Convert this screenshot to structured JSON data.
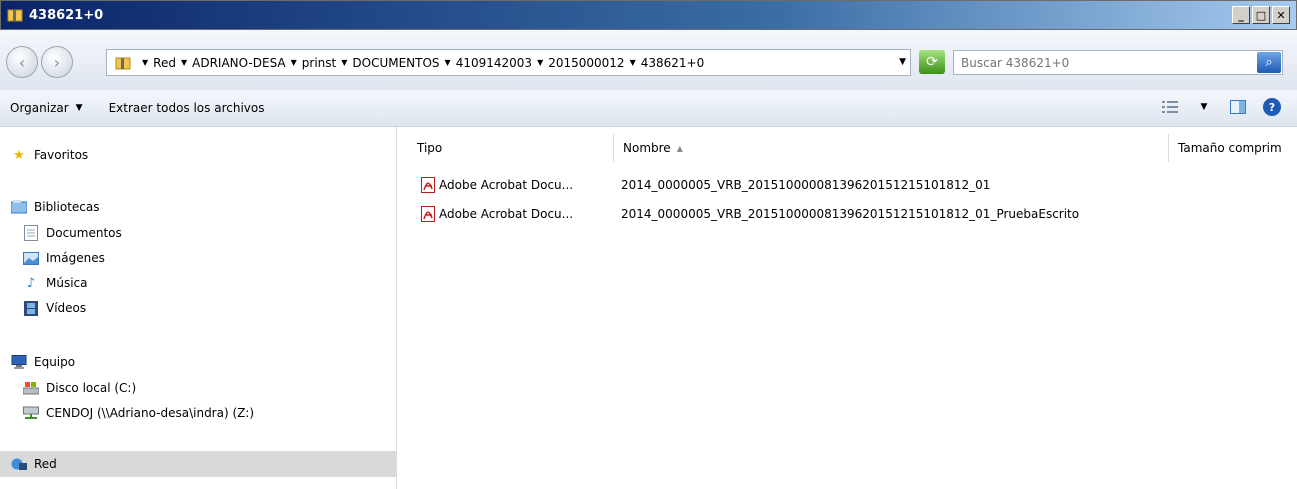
{
  "window": {
    "title": "438621+0",
    "buttons": [
      "_",
      "□",
      "✕"
    ]
  },
  "address": {
    "breadcrumbs": [
      "Red",
      "ADRIANO-DESA",
      "prinst",
      "DOCUMENTOS",
      "4109142003",
      "2015000012",
      "438621+0"
    ],
    "search_placeholder": "Buscar 438621+0"
  },
  "toolbar": {
    "organize_label": "Organizar",
    "extract_label": "Extraer todos los archivos"
  },
  "sidebar": {
    "favorites": "Favoritos",
    "libraries": "Bibliotecas",
    "library_items": [
      "Documentos",
      "Imágenes",
      "Música",
      "Vídeos"
    ],
    "computer": "Equipo",
    "drives": [
      "Disco local (C:)",
      "CENDOJ (\\\\Adriano-desa\\indra) (Z:)"
    ],
    "network": "Red"
  },
  "columns": {
    "type": "Tipo",
    "name": "Nombre",
    "size": "Tamaño comprim"
  },
  "files": [
    {
      "type": "Adobe Acrobat Docu...",
      "name": "2014_0000005_VRB_20151000008139620151215101812_01"
    },
    {
      "type": "Adobe Acrobat Docu...",
      "name": "2014_0000005_VRB_20151000008139620151215101812_01_PruebaEscrito"
    }
  ]
}
